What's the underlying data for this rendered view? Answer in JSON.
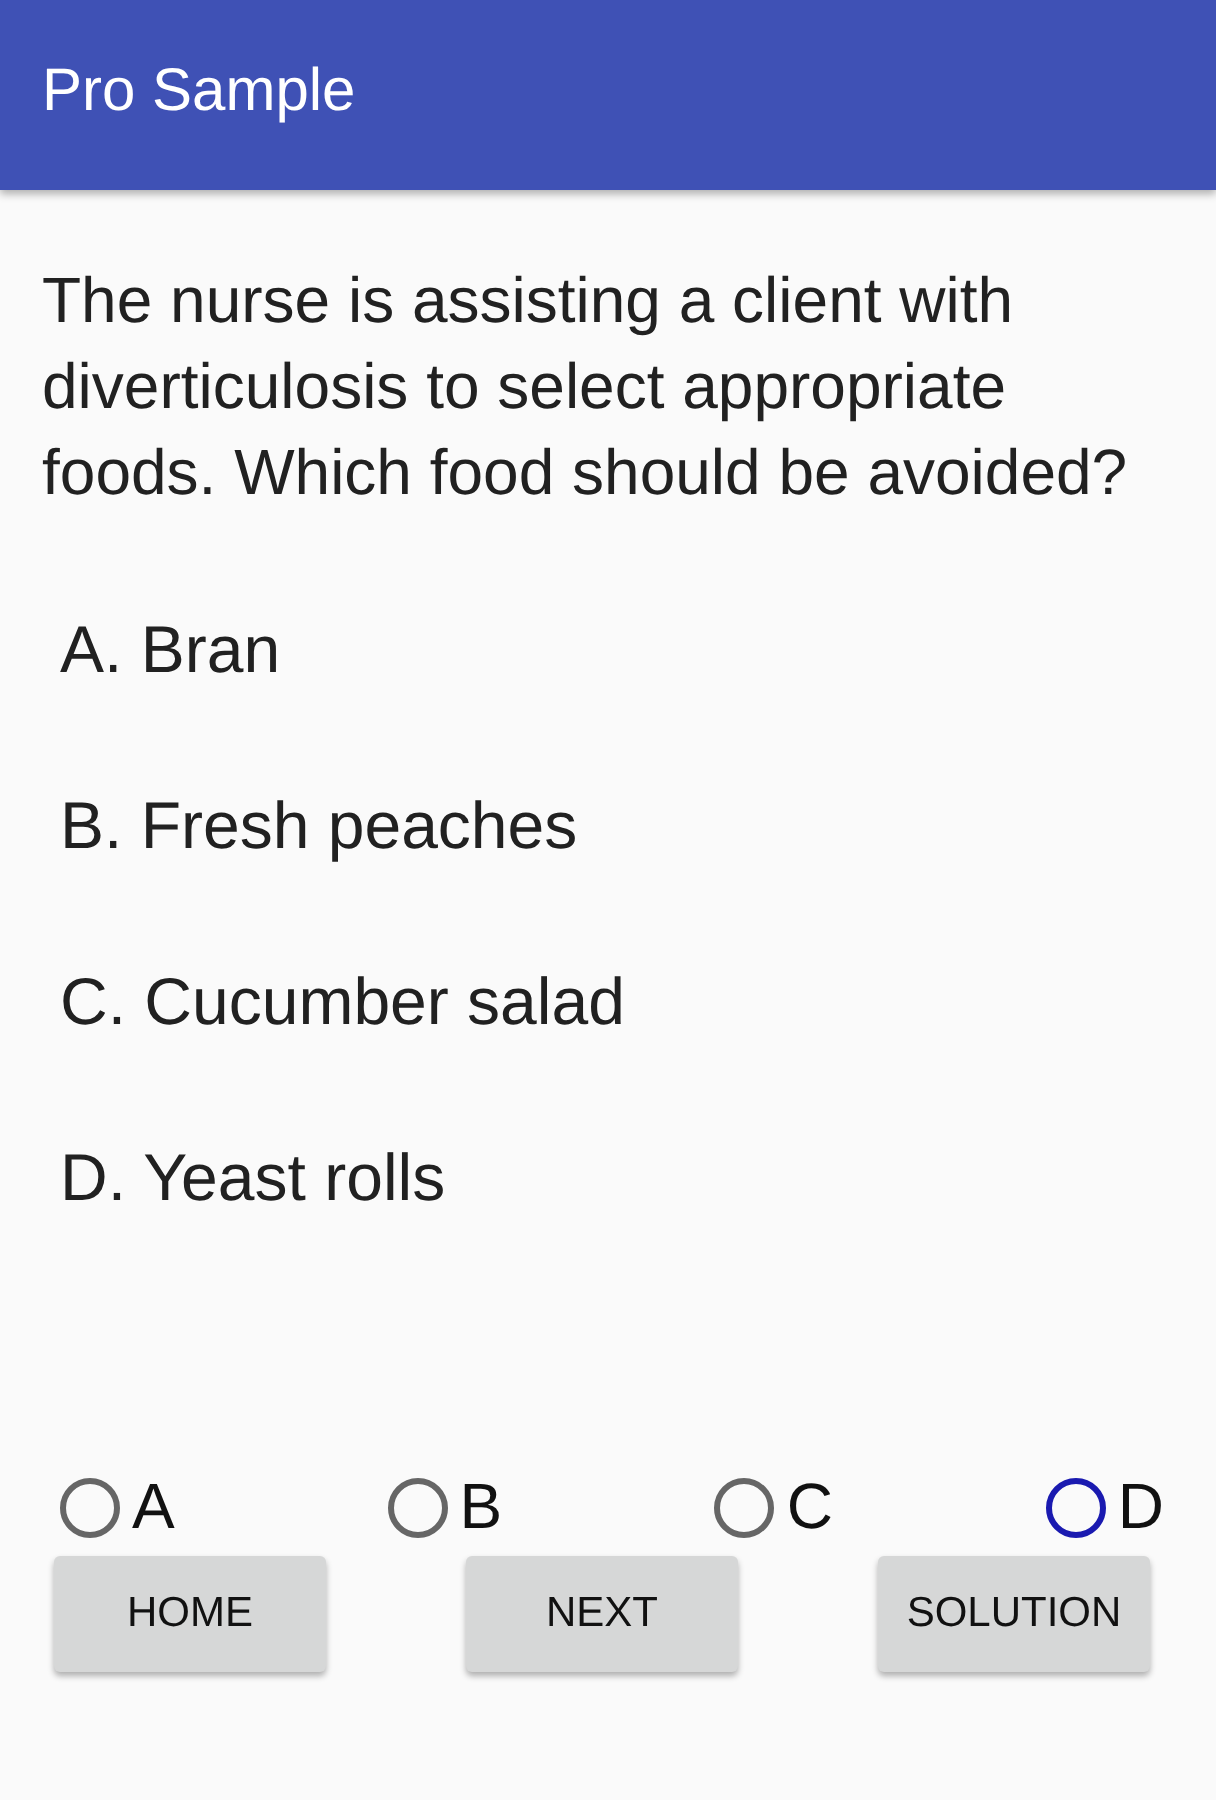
{
  "app_bar": {
    "title": "Pro Sample"
  },
  "question": "The nurse is assisting a client with diverticulosis to select appropriate foods. Which food should be avoided?",
  "options": [
    "A. Bran",
    "B. Fresh peaches",
    "C. Cucumber salad",
    "D. Yeast rolls"
  ],
  "answers": [
    {
      "label": "A",
      "selected": false,
      "focused": false
    },
    {
      "label": "B",
      "selected": false,
      "focused": false
    },
    {
      "label": "C",
      "selected": false,
      "focused": false
    },
    {
      "label": "D",
      "selected": false,
      "focused": true
    }
  ],
  "buttons": [
    "HOME",
    "NEXT",
    "SOLUTION"
  ]
}
